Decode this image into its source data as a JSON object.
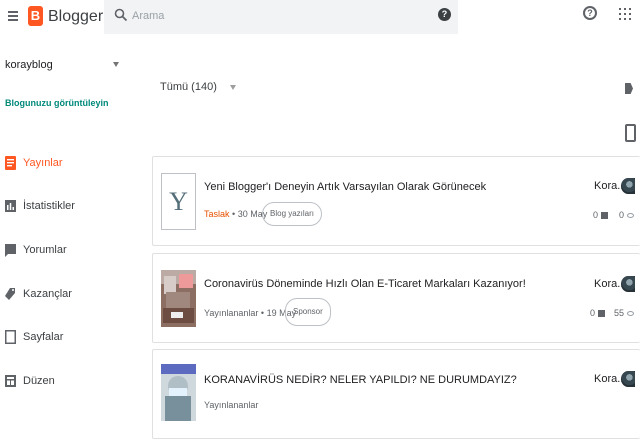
{
  "header": {
    "app_name": "Blogger",
    "logo_letter": "B",
    "search_placeholder": "Arama",
    "search_help_glyph": "?",
    "help_glyph": "?"
  },
  "sidebar": {
    "blog_name": "korayblog",
    "view_blog_label": "Blogunuzu görüntüleyin",
    "items": [
      {
        "label": "Yayınlar",
        "icon": "posts-icon",
        "active": true
      },
      {
        "label": "İstatistikler",
        "icon": "stats-icon",
        "active": false
      },
      {
        "label": "Yorumlar",
        "icon": "comments-icon",
        "active": false
      },
      {
        "label": "Kazançlar",
        "icon": "earnings-icon",
        "active": false
      },
      {
        "label": "Sayfalar",
        "icon": "pages-icon",
        "active": false
      },
      {
        "label": "Düzen",
        "icon": "layout-icon",
        "active": false
      }
    ]
  },
  "main": {
    "filter_label": "Tümü (140)",
    "posts": [
      {
        "title": "Yeni Blogger'ı Deneyin Artık Varsayılan Olarak Görünecek",
        "thumbnail_letter": "Y",
        "status": "Taslak",
        "date": "30 May",
        "label": "Blog yazıları",
        "author": "Kora...",
        "comments": "0",
        "views": "0"
      },
      {
        "title": "Coronavirüs Döneminde Hızlı Olan E-Ticaret Markaları Kazanıyor!",
        "status": "Yayınlananlar",
        "date": "19 May",
        "label": "Sponsor",
        "author": "Kora...",
        "comments": "0",
        "views": "55"
      },
      {
        "title": "KORANAVİRÜS NEDİR? NELER YAPILDI? NE DURUMDAYIZ?",
        "status": "Yayınlananlar",
        "date": "",
        "label": "",
        "author": "Kora...",
        "comments": "",
        "views": ""
      }
    ]
  },
  "colors": {
    "accent": "#ff5722",
    "link": "#00897b",
    "draft": "#e65100"
  }
}
